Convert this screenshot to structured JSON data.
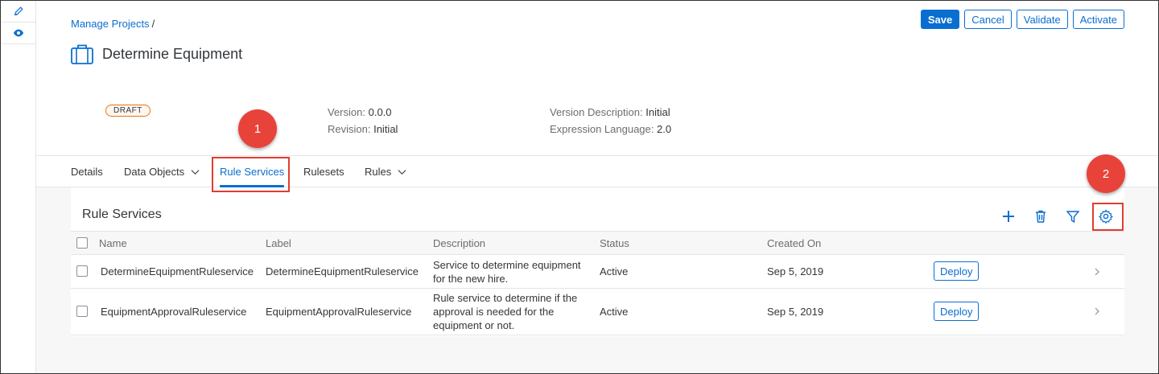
{
  "breadcrumb": {
    "link": "Manage Projects",
    "separator": "/"
  },
  "header": {
    "title": "Determine Equipment",
    "status_badge": "DRAFT",
    "version_label": "Version:",
    "version_value": "0.0.0",
    "revision_label": "Revision:",
    "revision_value": "Initial",
    "version_desc_label": "Version Description:",
    "version_desc_value": "Initial",
    "expr_lang_label": "Expression Language:",
    "expr_lang_value": "2.0"
  },
  "actions": {
    "save": "Save",
    "cancel": "Cancel",
    "validate": "Validate",
    "activate": "Activate"
  },
  "tabs": [
    {
      "label": "Details"
    },
    {
      "label": "Data Objects"
    },
    {
      "label": "Rule Services"
    },
    {
      "label": "Rulesets"
    },
    {
      "label": "Rules"
    }
  ],
  "active_tab": "Rule Services",
  "section": {
    "title": "Rule Services",
    "toolbar_icons": [
      "add-icon",
      "delete-icon",
      "filter-icon",
      "settings-icon"
    ]
  },
  "table": {
    "columns": [
      "Name",
      "Label",
      "Description",
      "Status",
      "Created On"
    ],
    "rows": [
      {
        "name": "DetermineEquipmentRuleservice",
        "label": "DetermineEquipmentRuleservice",
        "description": [
          "Service to determine equipment",
          "for the new hire."
        ],
        "status": "Active",
        "created_on": "Sep 5, 2019",
        "action": "Deploy"
      },
      {
        "name": "EquipmentApprovalRuleservice",
        "label": "EquipmentApprovalRuleservice",
        "description": [
          "Rule service to determine if the",
          "approval is needed for the",
          "equipment or not."
        ],
        "status": "Active",
        "created_on": "Sep 5, 2019",
        "action": "Deploy"
      }
    ]
  },
  "annotations": {
    "callout_1": "1",
    "callout_2": "2"
  },
  "colors": {
    "accent": "#0a6ed1",
    "annotation_red": "#e8433a",
    "draft_border": "#e9730c"
  }
}
